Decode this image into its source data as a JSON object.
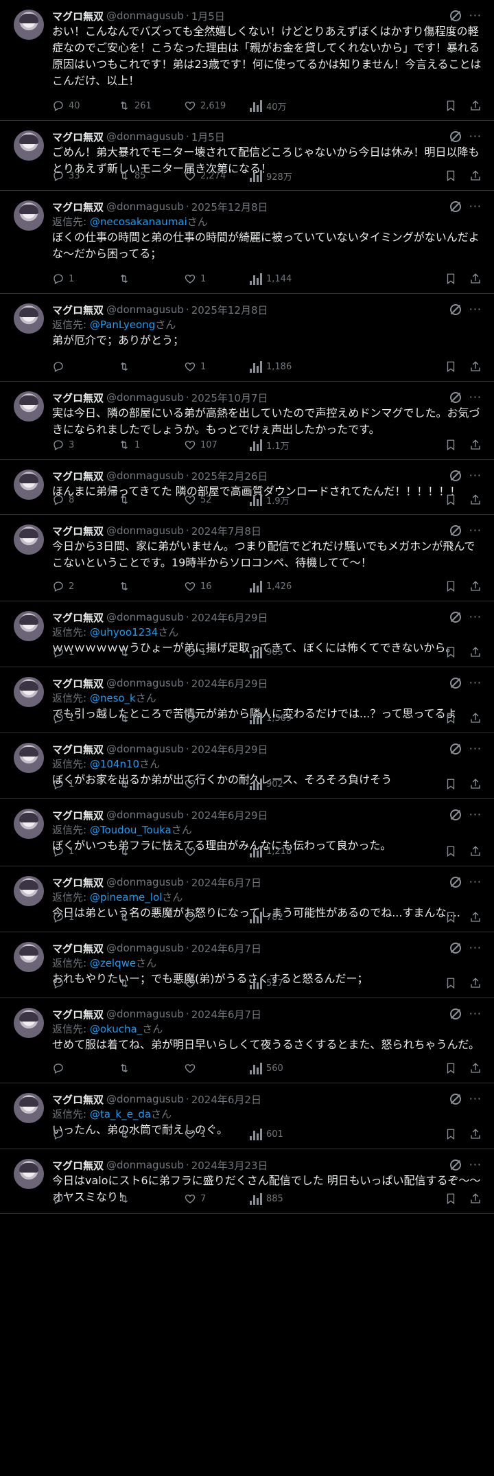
{
  "author": {
    "name": "マグロ無双",
    "handle": "@donmagusub"
  },
  "ui": {
    "reply_prefix": "返信先: ",
    "reply_suffix": "さん",
    "separator": "·"
  },
  "tweets": [
    {
      "date": "1月5日",
      "reply_to": "",
      "text": "おい！こんなんでバズっても全然嬉しくない！けどとりあえずぼくはかすり傷程度の軽症なのでご安心を！こうなった理由は「親がお金を貸してくれないから」です！暴れる原因はいつもこれです！弟は23歳です！何に使ってるかは知りません！今言えることはこんだけ、以上！",
      "replies": "40",
      "retweets": "261",
      "likes": "2,619",
      "views": "40万"
    },
    {
      "date": "1月5日",
      "reply_to": "",
      "text": "ごめん！弟大暴れでモニター壊されて配信どころじゃないから今日は休み！明日以降もとりあえず新しいモニター届き次第になる！",
      "replies": "33",
      "retweets": "85",
      "likes": "2,274",
      "views": "928万"
    },
    {
      "date": "2025年12月8日",
      "reply_to": "@necosakanaumai",
      "text": "ぼくの仕事の時間と弟の仕事の時間が綺麗に被っていていないタイミングがないんだよな〜だから困ってる；",
      "replies": "1",
      "retweets": "",
      "likes": "1",
      "views": "1,144"
    },
    {
      "date": "2025年12月8日",
      "reply_to": "@PanLyeong",
      "text": "弟が厄介で；ありがとう；",
      "replies": "",
      "retweets": "",
      "likes": "1",
      "views": "1,186"
    },
    {
      "date": "2025年10月7日",
      "reply_to": "",
      "text": "実は今日、隣の部屋にいる弟が高熱を出していたので声控えめドンマグでした。お気づきになられましたでしょうか。もっとでけぇ声出したかったです。",
      "replies": "3",
      "retweets": "1",
      "likes": "107",
      "views": "1.1万"
    },
    {
      "date": "2025年2月26日",
      "reply_to": "",
      "text": "ほんまに弟帰ってきてた 隣の部屋で高画質ダウンロードされてたんだ！！！！！！",
      "replies": "8",
      "retweets": "",
      "likes": "52",
      "views": "1.9万"
    },
    {
      "date": "2024年7月8日",
      "reply_to": "",
      "text": "今日から3日間、家に弟がいません。つまり配信でどれだけ騒いでもメガホンが飛んでこないということです。19時半からソロコンペ、待機してて〜！",
      "replies": "2",
      "retweets": "",
      "likes": "16",
      "views": "1,426"
    },
    {
      "date": "2024年6月29日",
      "reply_to": "@uhyoo1234",
      "text": "ｗｗｗｗｗｗｗうひょーが弟に揚げ足取ってきて、ぼくには怖くてできないから。",
      "replies": "1",
      "retweets": "",
      "likes": "1",
      "views": "905"
    },
    {
      "date": "2024年6月29日",
      "reply_to": "@neso_k",
      "text": "でも引っ越したところで苦情元が弟から隣人に変わるだけでは...？って思ってるよ",
      "replies": "1",
      "retweets": "",
      "likes": "",
      "views": "1,369"
    },
    {
      "date": "2024年6月29日",
      "reply_to": "@104n10",
      "text": "ぼくがお家を出るか弟が出て行くかの耐久レース、そろそろ負けそう",
      "replies": "1",
      "retweets": "",
      "likes": "",
      "views": "902"
    },
    {
      "date": "2024年6月29日",
      "reply_to": "@Toudou_Touka",
      "text": "ぼくがいつも弟フラに怯えてる理由がみんなにも伝わって良かった。",
      "replies": "1",
      "retweets": "",
      "likes": "",
      "views": "1,218"
    },
    {
      "date": "2024年6月7日",
      "reply_to": "@pineame_lol",
      "text": "今日は弟という名の悪魔がお怒りになってしまう可能性があるのでね...すまんな....",
      "replies": "1",
      "retweets": "",
      "likes": "",
      "views": "782"
    },
    {
      "date": "2024年6月7日",
      "reply_to": "@zelqwe",
      "text": "おれもやりたいー；でも悪魔(弟)がうるさくすると怒るんだー；",
      "replies": "",
      "retweets": "",
      "likes": "",
      "views": "527"
    },
    {
      "date": "2024年6月7日",
      "reply_to": "@okucha_",
      "text": "せめて服は着てね、弟が明日早いらしくて夜うるさくするとまた、怒られちゃうんだ。",
      "replies": "",
      "retweets": "",
      "likes": "",
      "views": "560"
    },
    {
      "date": "2024年6月2日",
      "reply_to": "@ta_k_e_da",
      "text": "いったん、弟の水筒で耐えしのぐ。",
      "replies": "",
      "retweets": "",
      "likes": "1",
      "views": "601"
    },
    {
      "date": "2024年3月23日",
      "reply_to": "",
      "text": "今日はvaloにスト6に弟フラに盛りだくさん配信でした 明日もいっぱい配信するぞ〜〜オヤスミなり！",
      "replies": "",
      "retweets": "",
      "likes": "7",
      "views": "885"
    }
  ]
}
